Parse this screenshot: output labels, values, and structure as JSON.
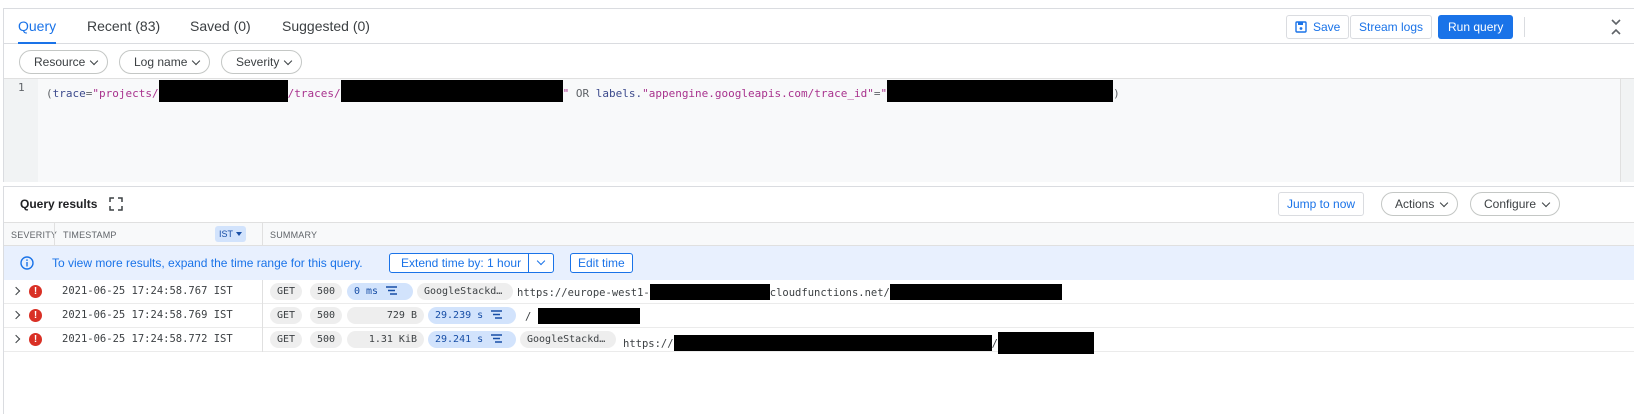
{
  "tabs": [
    {
      "label": "Query",
      "active": true
    },
    {
      "label": "Recent (83)"
    },
    {
      "label": "Saved (0)"
    },
    {
      "label": "Suggested (0)"
    }
  ],
  "toolbar": {
    "save_label": "Save",
    "stream_label": "Stream logs",
    "run_label": "Run query"
  },
  "filters": [
    "Resource",
    "Log name",
    "Severity"
  ],
  "editor": {
    "line_number": "1",
    "tokens": [
      "(",
      "trace",
      "=",
      "\"projects/",
      "/traces/",
      "\"",
      "OR",
      "labels.",
      "\"appengine.googleapis.com/trace_id\"",
      "=",
      "\"",
      ")"
    ]
  },
  "results": {
    "title": "Query results",
    "jump_label": "Jump to now",
    "actions_label": "Actions",
    "configure_label": "Configure",
    "columns": {
      "severity": "SEVERITY",
      "timestamp": "TIMESTAMP",
      "timezone": "IST",
      "summary": "SUMMARY"
    },
    "info": {
      "text": "To view more results, expand the time range for this query.",
      "extend_label": "Extend time by: 1 hour",
      "edit_label": "Edit time"
    },
    "rows": [
      {
        "severity": "!",
        "timestamp": "2021-06-25 17:24:58.767 IST",
        "method": "GET",
        "status": "500",
        "size": "0 ms",
        "latency": "",
        "agent": "GoogleStackd…",
        "url_prefix": "https://europe-west1-",
        "url_mid": "cloudfunctions.net/",
        "url_suffix": ""
      },
      {
        "severity": "!",
        "timestamp": "2021-06-25 17:24:58.769 IST",
        "method": "GET",
        "status": "500",
        "size": "729 B",
        "latency": "29.239 s",
        "agent": "",
        "url_prefix": "/",
        "url_mid": "",
        "url_suffix": ""
      },
      {
        "severity": "!",
        "timestamp": "2021-06-25 17:24:58.772 IST",
        "method": "GET",
        "status": "500",
        "size": "1.31 KiB",
        "latency": "29.241 s",
        "agent": "GoogleStackd…",
        "url_prefix": "https://",
        "url_mid": "/",
        "url_suffix": ""
      }
    ]
  },
  "colors": {
    "accent": "#1a73e8",
    "error": "#d93025",
    "info_bg": "#e8f0fe",
    "latency_bg": "#d2e3fc"
  },
  "icons": [
    "save-icon",
    "collapse-icon",
    "fullscreen-icon",
    "info-icon",
    "expand-caret-icon",
    "error-icon",
    "waterfall-icon",
    "chevron-down-icon"
  ]
}
